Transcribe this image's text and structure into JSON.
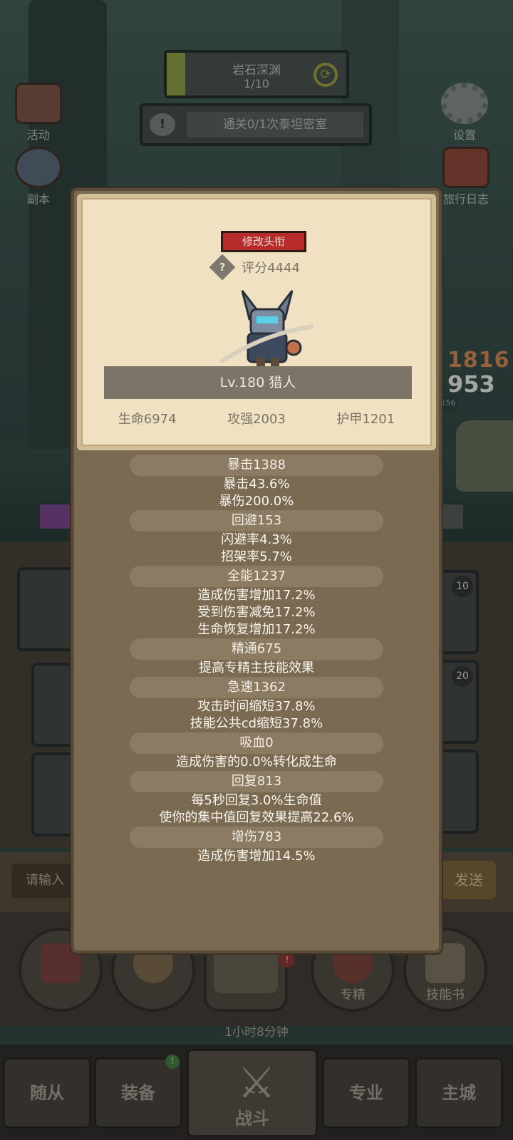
{
  "stage": {
    "name": "岩石深渊",
    "progress": "1/10"
  },
  "quest": {
    "text": "通关0/1次泰坦密室"
  },
  "side_left": [
    {
      "label": "活动"
    },
    {
      "label": "副本"
    }
  ],
  "side_right": [
    {
      "label": "设置"
    },
    {
      "label": "旅行日志"
    }
  ],
  "scene": {
    "score_top": "1816",
    "score_mid": "953",
    "level_badge": "156"
  },
  "slots": [
    {
      "badge": "10"
    },
    {
      "badge": "20"
    }
  ],
  "chat": {
    "placeholder": "请输入",
    "send": "发送"
  },
  "actions": [
    {
      "label": ""
    },
    {
      "label": ""
    },
    {
      "label": ""
    },
    {
      "label": "专精"
    },
    {
      "label": "技能书"
    }
  ],
  "chest": {
    "timer": "1小时8分钟",
    "badge": "!"
  },
  "nav": [
    {
      "label": "随从"
    },
    {
      "label": "装备"
    },
    {
      "label": "战斗"
    },
    {
      "label": "专业"
    },
    {
      "label": "主城"
    }
  ],
  "nav_badge": "!",
  "card": {
    "rename_button": "修改头衔",
    "score": "评分4444",
    "help_icon": "?",
    "level_class": "Lv.180 猎人",
    "stats": {
      "hp": "生命6974",
      "attack": "攻强2003",
      "armor": "护甲1201"
    }
  },
  "stat_groups": [
    {
      "head": "暴击1388",
      "lines": [
        "暴击43.6%",
        "暴伤200.0%"
      ]
    },
    {
      "head": "回避153",
      "lines": [
        "闪避率4.3%",
        "招架率5.7%"
      ]
    },
    {
      "head": "全能1237",
      "lines": [
        "造成伤害增加17.2%",
        "受到伤害减免17.2%",
        "生命恢复增加17.2%"
      ]
    },
    {
      "head": "精通675",
      "lines": [
        "提高专精主技能效果"
      ]
    },
    {
      "head": "急速1362",
      "lines": [
        "攻击时间缩短37.8%",
        "技能公共cd缩短37.8%"
      ]
    },
    {
      "head": "吸血0",
      "lines": [
        "造成伤害的0.0%转化成生命"
      ]
    },
    {
      "head": "回复813",
      "lines": [
        "每5秒回复3.0%生命值",
        "使你的集中值回复效果提高22.6%"
      ]
    },
    {
      "head": "增伤783",
      "lines": [
        "造成伤害增加14.5%"
      ]
    }
  ],
  "colors": {
    "rename_bg": "#b82b2b",
    "card_bg": "#efe1c2",
    "modal_bg": "#7a6a52"
  }
}
